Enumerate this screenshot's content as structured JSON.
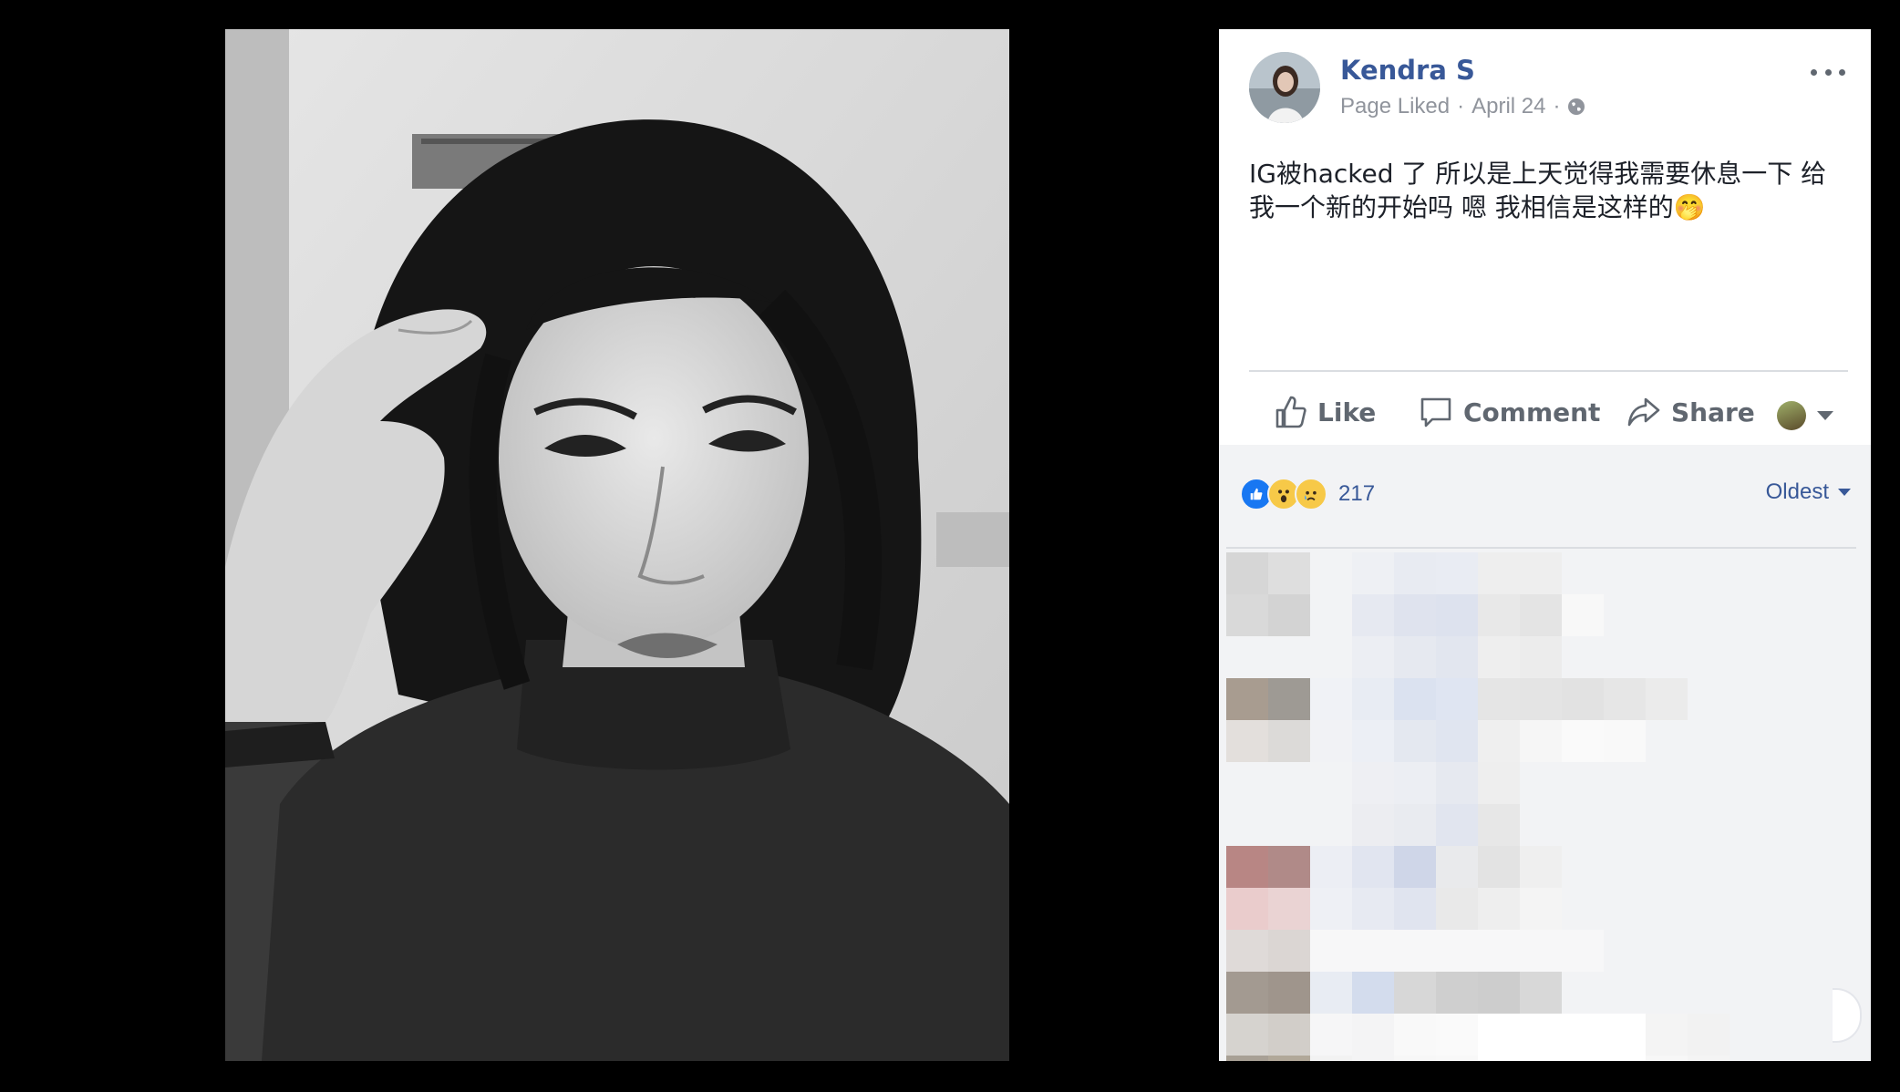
{
  "post": {
    "author": "Kendra S",
    "meta_action": "Page Liked",
    "meta_separator": "·",
    "date": "April 24",
    "text": "IG被hacked 了 所以是上天觉得我需要休息一下 给我一个新的开始吗 嗯 我相信是这样的🤭"
  },
  "actions": {
    "like_label": "Like",
    "comment_label": "Comment",
    "share_label": "Share"
  },
  "reactions": {
    "count": "217",
    "types": [
      "like-icon",
      "wow-icon",
      "sad-icon"
    ]
  },
  "comments": {
    "sort_label": "Oldest"
  },
  "colors": {
    "author": "#385898",
    "action_text": "#606770",
    "meta_text": "#90949c",
    "panel_bg": "#ffffff",
    "comments_bg": "#f2f3f5",
    "page_bg": "#000000"
  }
}
